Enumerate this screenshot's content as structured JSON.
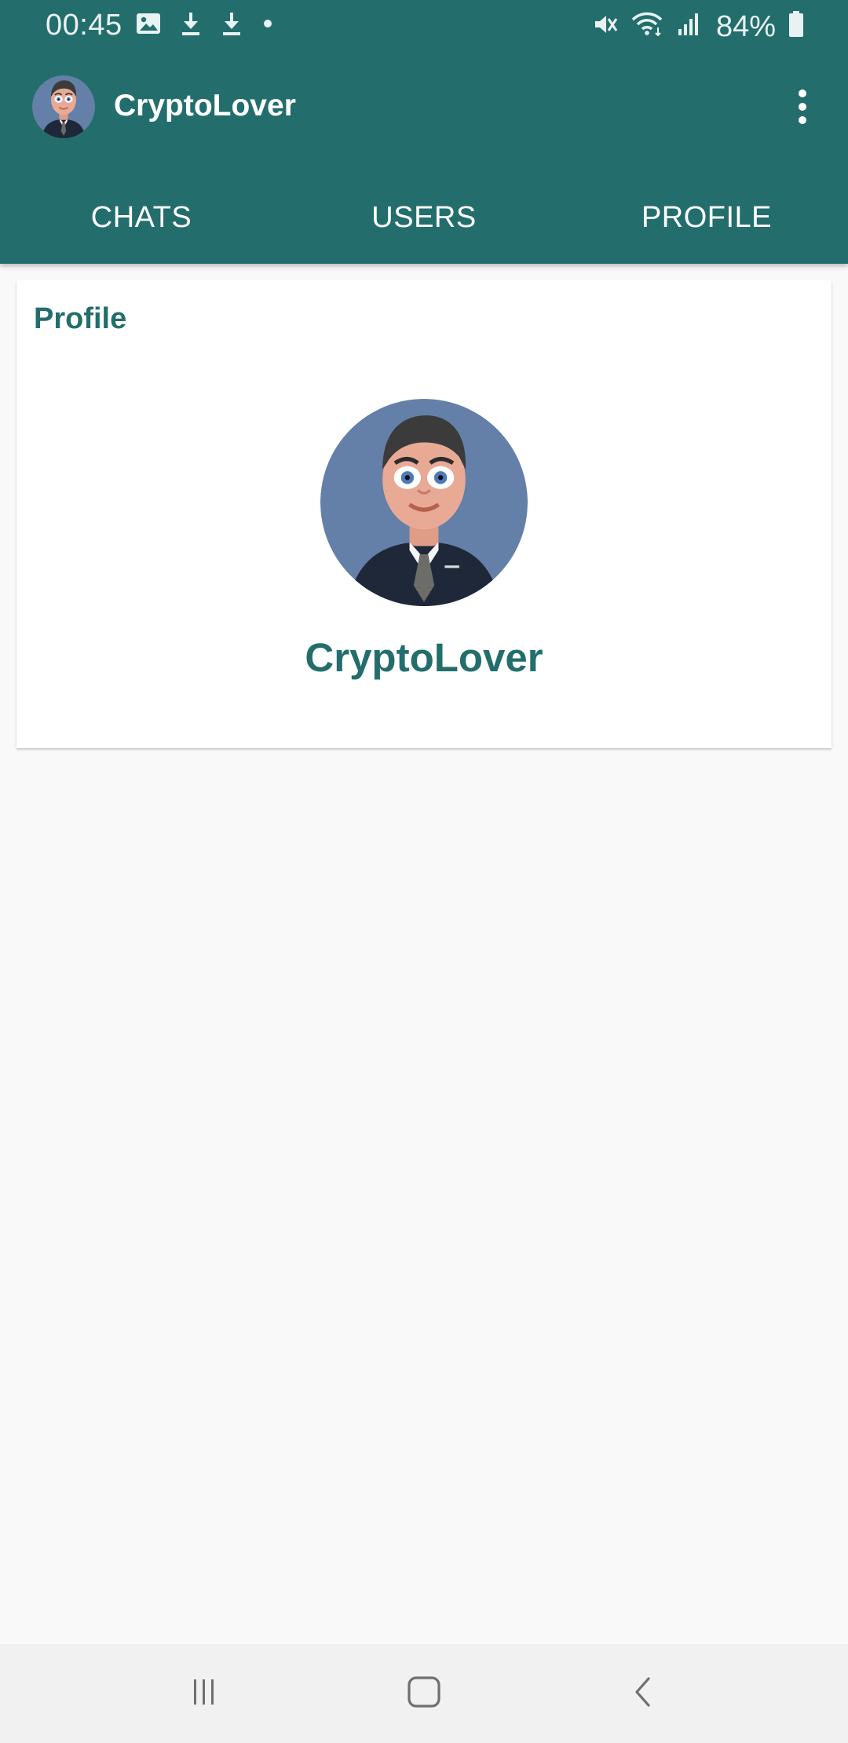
{
  "status_bar": {
    "time": "00:45",
    "battery": "84%",
    "left_icons": [
      "image-icon",
      "download-icon",
      "download-icon",
      "dot-icon"
    ],
    "right_icons": [
      "mute-icon",
      "wifi-icon",
      "signal-icon",
      "battery-icon"
    ]
  },
  "toolbar": {
    "title": "CryptoLover",
    "menu_icon": "more-vert-icon",
    "avatar_icon": "avatar-icon"
  },
  "tabs": [
    {
      "label": "CHATS"
    },
    {
      "label": "USERS"
    },
    {
      "label": "PROFILE"
    }
  ],
  "profile": {
    "heading": "Profile",
    "name": "CryptoLover"
  },
  "nav": {
    "recents_icon": "recents-icon",
    "home_icon": "home-icon",
    "back_icon": "back-icon"
  },
  "colors": {
    "accent": "#236e6d",
    "background": "#f9f9f9",
    "card": "#ffffff",
    "nav": "#f1f1f1"
  }
}
